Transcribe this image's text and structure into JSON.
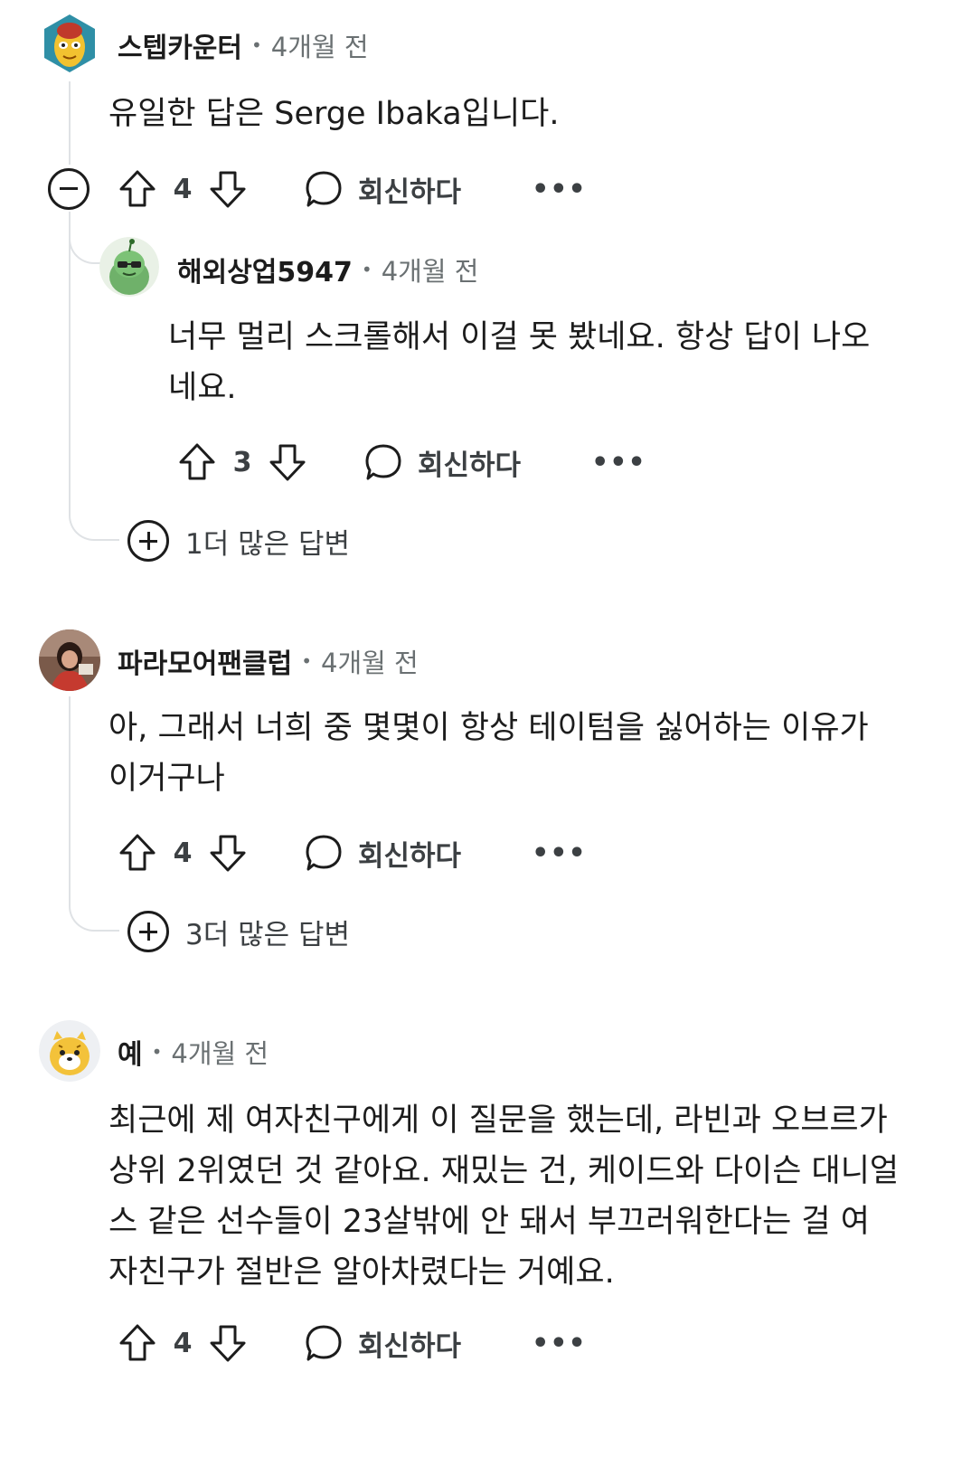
{
  "comments": [
    {
      "username": "스텝카운터",
      "time": "4개월 전",
      "body": "유일한 답은 Serge Ibaka입니다.",
      "votes": "4",
      "reply_label": "회신하다",
      "more_label": "•••",
      "replies": [
        {
          "username": "해외상업5947",
          "time": "4개월 전",
          "body_lines": [
            "너무 멀리 스크롤해서 이걸 못 봤네요. 항상 답이 나오",
            "네요."
          ],
          "votes": "3",
          "reply_label": "회신하다",
          "more_label": "•••"
        }
      ],
      "more_replies_label": "1더 많은 답변"
    },
    {
      "username": "파라모어팬클럽",
      "time": "4개월 전",
      "body_lines": [
        "아, 그래서 너희 중 몇몇이 항상 테이텀을 싫어하는 이유가",
        "이거구나"
      ],
      "votes": "4",
      "reply_label": "회신하다",
      "more_label": "•••",
      "more_replies_label": "3더 많은 답변"
    },
    {
      "username": "예",
      "time": "4개월 전",
      "body_lines": [
        "최근에 제 여자친구에게 이 질문을 했는데, 라빈과 오브르가",
        "상위 2위였던 것 같아요. 재밌는 건, 케이드와 다이슨 대니얼",
        "스 같은 선수들이 23살밖에 안 돼서 부끄러워한다는 걸 여",
        "자친구가 절반은 알아차렸다는 거예요."
      ],
      "votes": "4",
      "reply_label": "회신하다",
      "more_label": "•••"
    }
  ],
  "meta_separator": "•",
  "icons": {
    "upvote": "arrow-up-icon",
    "downvote": "arrow-down-icon",
    "reply": "speech-bubble-icon",
    "collapse": "minus-circle-icon",
    "expand": "plus-circle-icon"
  }
}
